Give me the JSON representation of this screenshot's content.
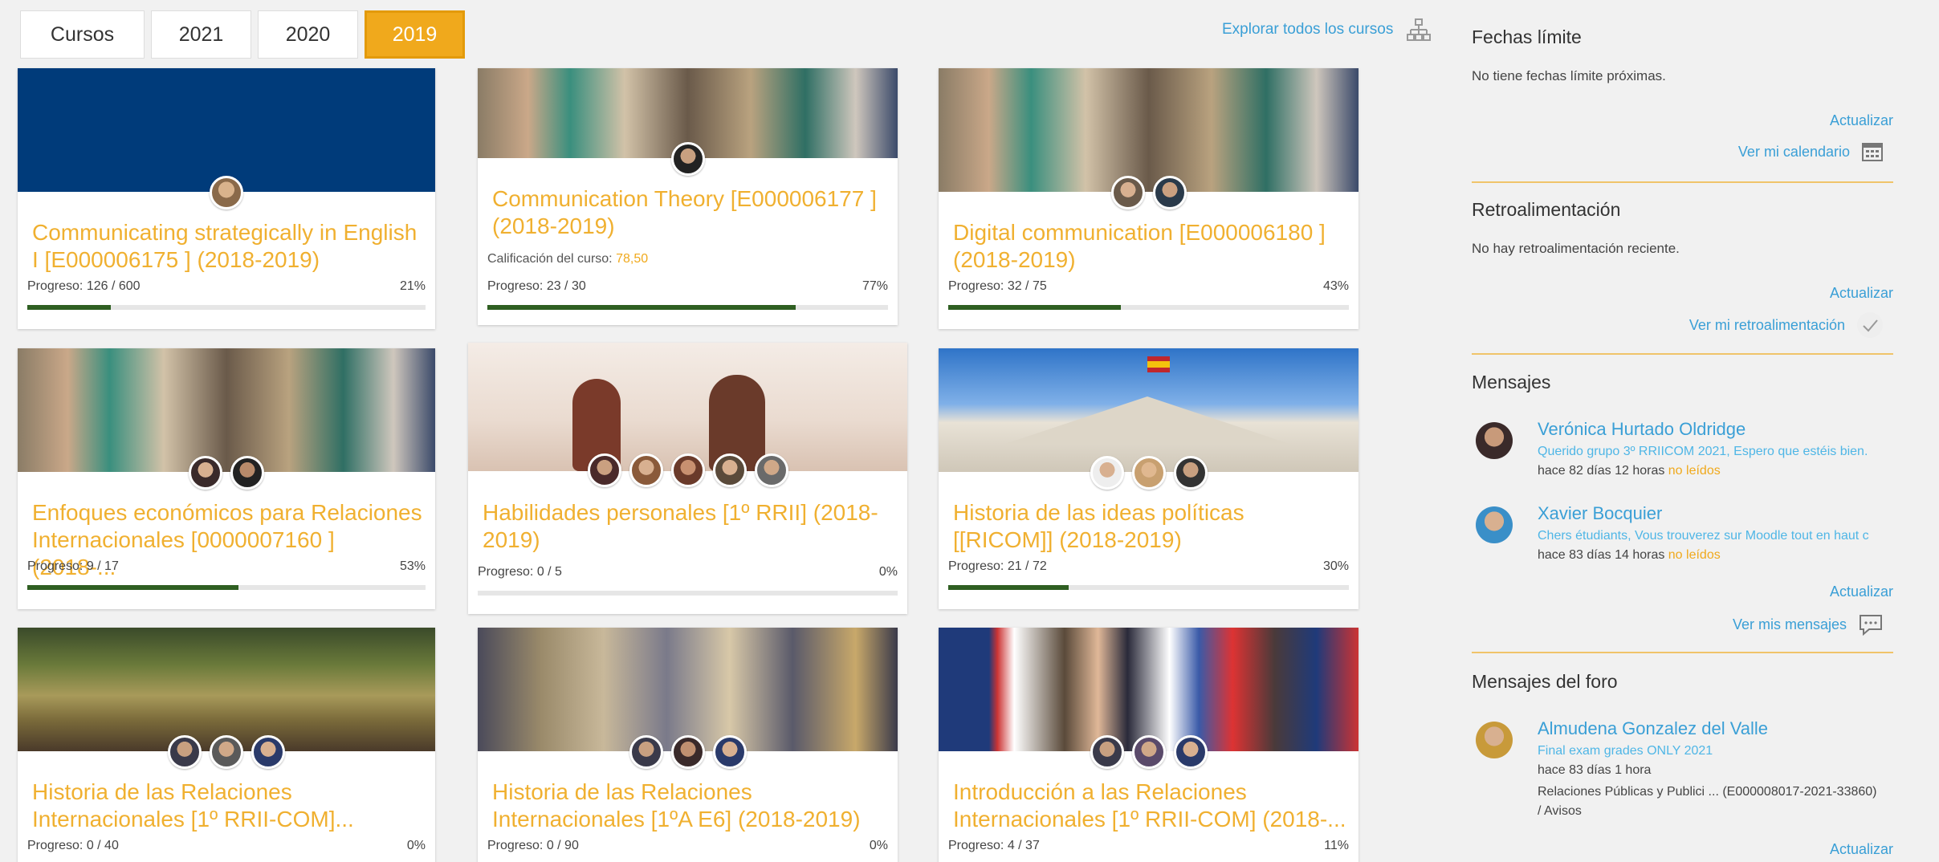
{
  "tabs": [
    "Cursos",
    "2021",
    "2020",
    "2019"
  ],
  "explore_label": "Explorar todos los cursos",
  "cards": [
    {
      "title": "Communicating strategically in English I [E000006175 ] (2018-2019)",
      "grade_label": "",
      "grade_value": "",
      "progress_text": "Progreso: 126 / 600",
      "percent": "21%",
      "progress": 0.21
    },
    {
      "title": "Communication Theory [E000006177 ] (2018-2019)",
      "grade_label": "Calificación del curso: ",
      "grade_value": "78,50",
      "progress_text": "Progreso: 23 / 30",
      "percent": "77%",
      "progress": 0.77
    },
    {
      "title": "Digital communication [E000006180 ] (2018-2019)",
      "grade_label": "",
      "grade_value": "",
      "progress_text": "Progreso: 32 / 75",
      "percent": "43%",
      "progress": 0.43
    },
    {
      "title": "Enfoques económicos para Relaciones Internacionales [0000007160 ] (2018-...",
      "grade_label": "",
      "grade_value": "",
      "progress_text": "Progreso: 9 / 17",
      "percent": "53%",
      "progress": 0.53
    },
    {
      "title": "Habilidades personales [1º RRII] (2018-2019)",
      "grade_label": "",
      "grade_value": "",
      "progress_text": "Progreso: 0 / 5",
      "percent": "0%",
      "progress": 0
    },
    {
      "title": "Historia de las ideas políticas [[RICOM]] (2018-2019)",
      "grade_label": "",
      "grade_value": "",
      "progress_text": "Progreso: 21 / 72",
      "percent": "30%",
      "progress": 0.3
    },
    {
      "title": "Historia de las Relaciones Internacionales [1º RRII-COM]...",
      "grade_label": "",
      "grade_value": "",
      "progress_text": "Progreso: 0 / 40",
      "percent": "0%",
      "progress": 0
    },
    {
      "title": "Historia de las Relaciones Internacionales [1ºA E6] (2018-2019)",
      "grade_label": "",
      "grade_value": "",
      "progress_text": "Progreso: 0 / 90",
      "percent": "0%",
      "progress": 0
    },
    {
      "title": "Introducción a las Relaciones Internacionales [1º RRII-COM] (2018-...",
      "grade_label": "",
      "grade_value": "",
      "progress_text": "Progreso: 4 / 37",
      "percent": "11%",
      "progress": 0.11
    }
  ],
  "sidebar": {
    "deadlines": {
      "title": "Fechas límite",
      "text": "No tiene fechas límite próximas.",
      "refresh": "Actualizar",
      "link": "Ver mi calendario",
      "icon": "calendar-icon"
    },
    "feedback": {
      "title": "Retroalimentación",
      "text": "No hay retroalimentación reciente.",
      "refresh": "Actualizar",
      "link": "Ver mi retroalimentación",
      "icon": "check-icon"
    },
    "messages": {
      "title": "Mensajes",
      "items": [
        {
          "name": "Verónica Hurtado Oldridge",
          "snippet": "Querido grupo 3º RRIICOM 2021, Espero que estéis bien.",
          "time": "hace 82 días 12 horas ",
          "status": "no leídos"
        },
        {
          "name": "Xavier Bocquier",
          "snippet": "Chers étudiants, Vous trouverez sur Moodle tout en haut c",
          "time": "hace 83 días 14 horas ",
          "status": "no leídos"
        }
      ],
      "refresh": "Actualizar",
      "link": "Ver mis mensajes",
      "icon": "chat-icon"
    },
    "forum": {
      "title": "Mensajes del foro",
      "item": {
        "name": "Almudena Gonzalez del Valle",
        "snippet": "Final exam grades ONLY 2021",
        "time": "hace 83 días 1 hora",
        "context": "Relaciones Públicas y Publici ... (E000008017-2021-33860) / Avisos"
      },
      "refresh": "Actualizar"
    }
  },
  "colors": {
    "accent": "#f0a91c",
    "link": "#3a9fd6",
    "progress": "#2f5f22"
  }
}
